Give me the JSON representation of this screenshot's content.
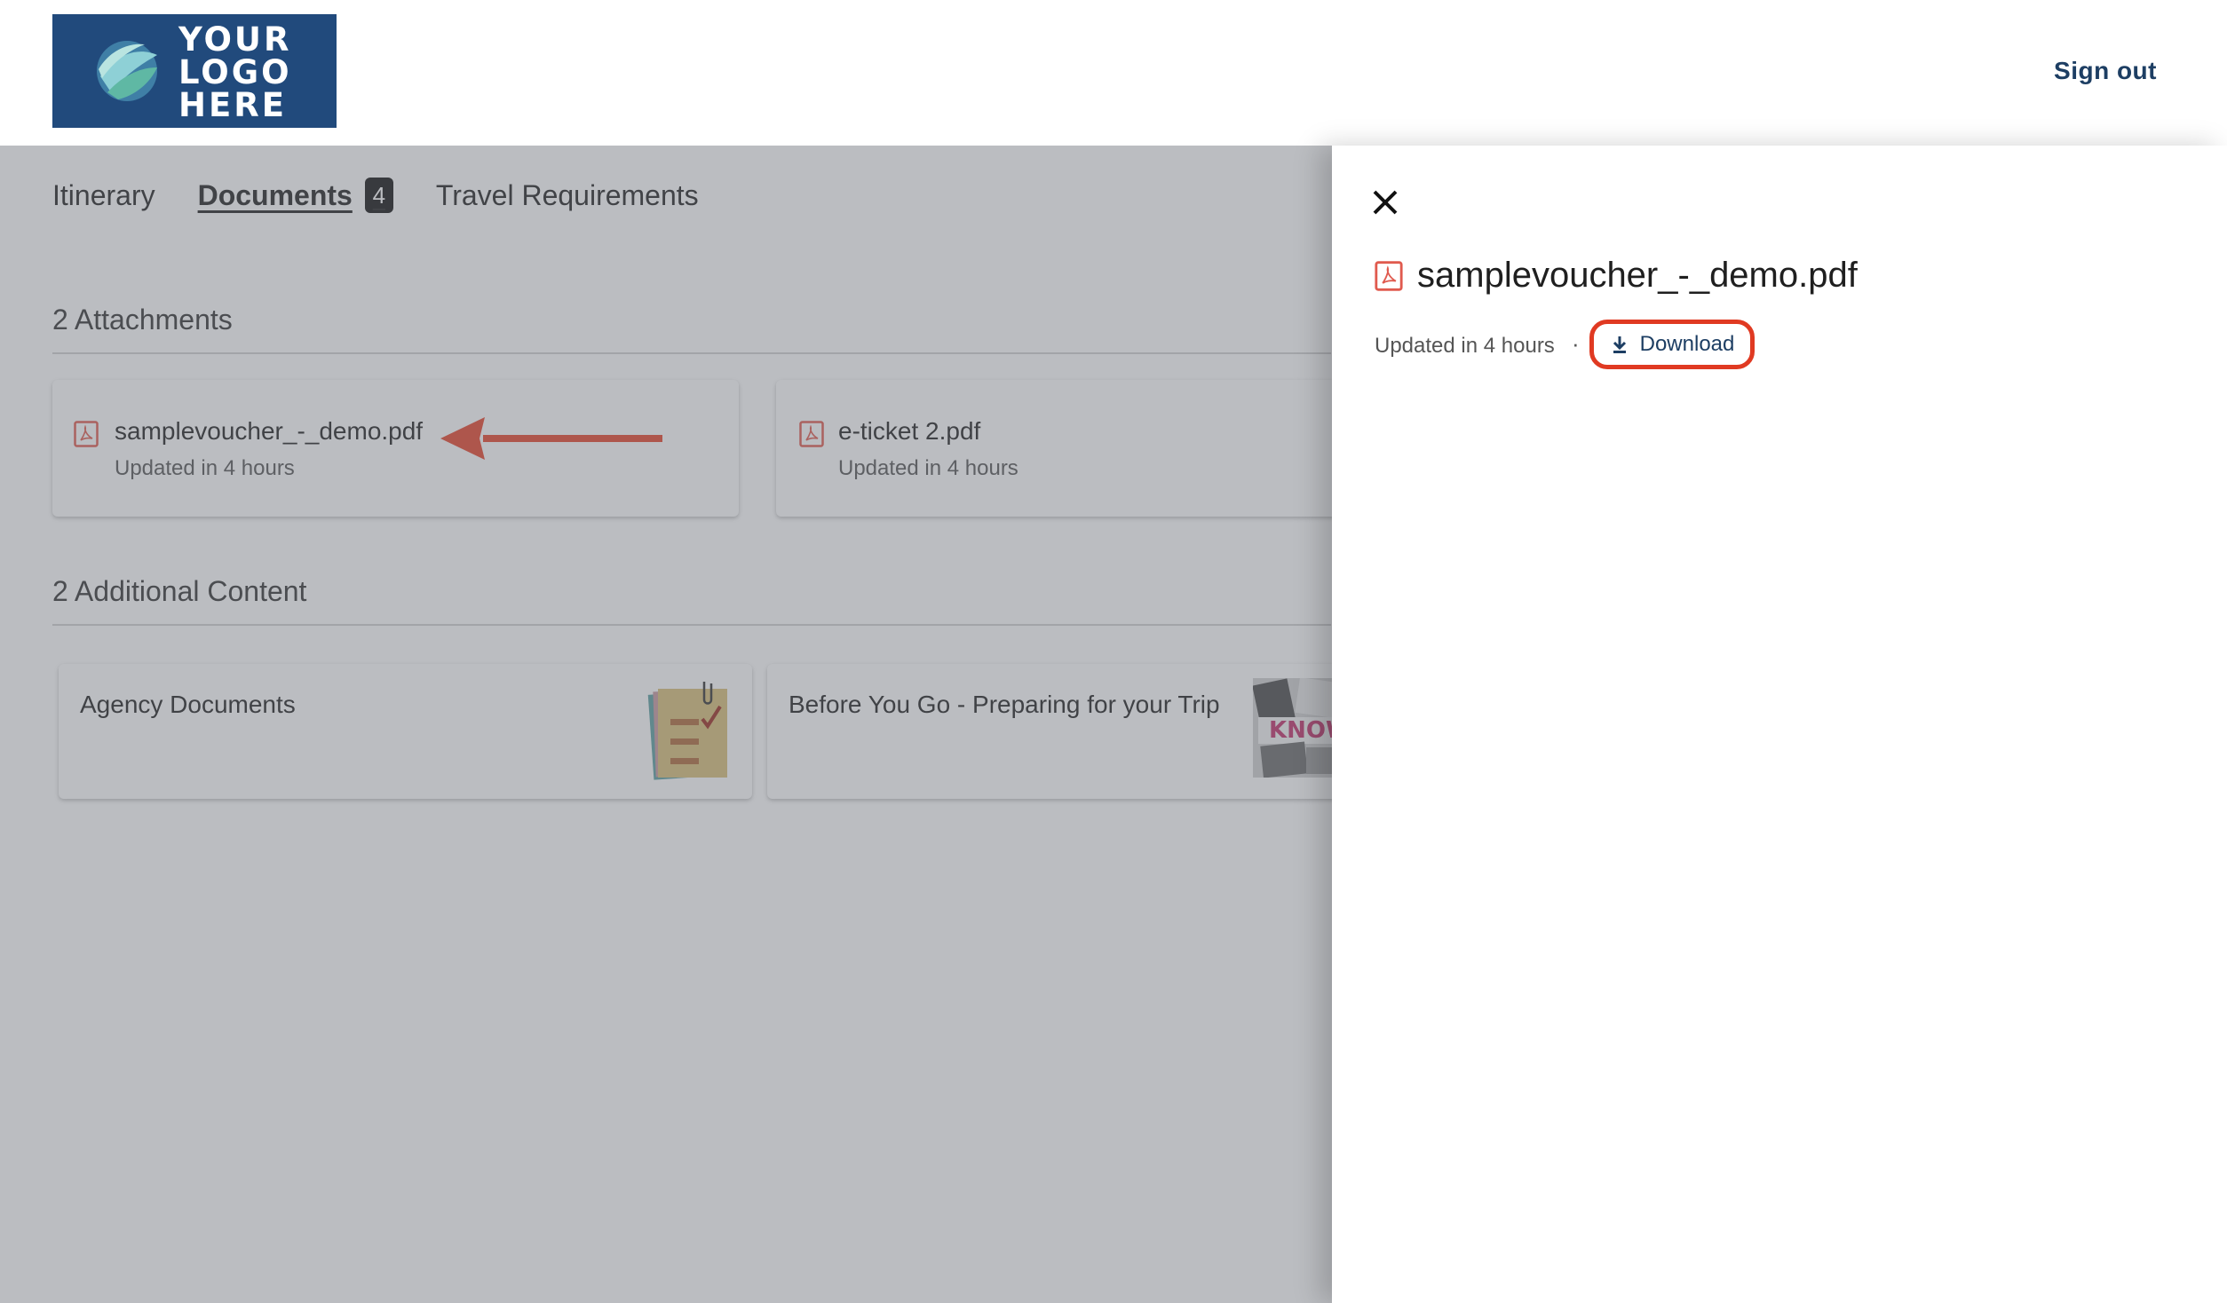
{
  "header": {
    "logo_lines": [
      "YOUR",
      "LOGO",
      "HERE"
    ],
    "sign_out_label": "Sign out"
  },
  "tabs": [
    {
      "label": "Itinerary",
      "active": false
    },
    {
      "label": "Documents",
      "active": true,
      "badge": "4"
    },
    {
      "label": "Travel Requirements",
      "active": false
    }
  ],
  "attachments": {
    "title": "2 Attachments",
    "items": [
      {
        "name": "samplevoucher_-_demo.pdf",
        "updated": "Updated in 4 hours",
        "icon": "pdf-icon"
      },
      {
        "name": "e-ticket 2.pdf",
        "updated": "Updated in 4 hours",
        "icon": "pdf-icon"
      }
    ]
  },
  "additional": {
    "title": "2 Additional Content",
    "items": [
      {
        "title": "Agency Documents",
        "thumbnail": "clipboard-checklist-icon"
      },
      {
        "title": "Before You Go - Preparing for your Trip",
        "thumbnail": "magazine-thumbnail",
        "thumb_text": "KNOW"
      }
    ]
  },
  "drawer": {
    "file_name": "samplevoucher_-_demo.pdf",
    "updated": "Updated in 4 hours",
    "separator": "·",
    "download_label": "Download"
  },
  "colors": {
    "logo_bg": "#214a7c",
    "link": "#1d3e63",
    "highlight": "#e03a22",
    "pdf_red": "#e05a4e",
    "scrim": "#696c76"
  }
}
